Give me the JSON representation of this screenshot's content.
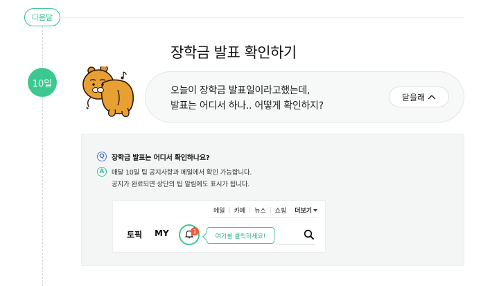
{
  "timeline": {
    "next_month_label": "다음달",
    "day_label": "10일"
  },
  "title": "장학금 발표 확인하기",
  "bubble": {
    "lines": [
      "오늘이 장학금 발표일이라고했는데,",
      "발표는 어디서 하나.. 어떻게 확인하지?"
    ],
    "close_label": "닫을래"
  },
  "qa": {
    "q_icon": "Q",
    "question": "장학금 발표는 어디서 확인하나요?",
    "a_icon": "A",
    "answer_lines": [
      "매달 10일 팁 공지사항과 메일에서 확인 가능합니다.",
      "공지가 완료되면 상단의 팁 알림에도 표시가 됩니다."
    ]
  },
  "mock_site": {
    "nav": [
      "메일",
      "카페",
      "뉴스",
      "쇼핑"
    ],
    "more_label": "더보기",
    "tabs": [
      "토픽",
      "MY"
    ],
    "notification_count": "1",
    "click_hint": "여기를 클릭하세요!"
  },
  "icons": {
    "character": "kakao-ryan-character",
    "bell": "bell-icon",
    "search": "search-icon",
    "chevron_up": "chevron-up-icon",
    "caret_down": "caret-down-icon"
  },
  "colors": {
    "accent_green": "#3cc98f",
    "q_blue": "#4b6fd3",
    "badge_red": "#f05a3c"
  }
}
